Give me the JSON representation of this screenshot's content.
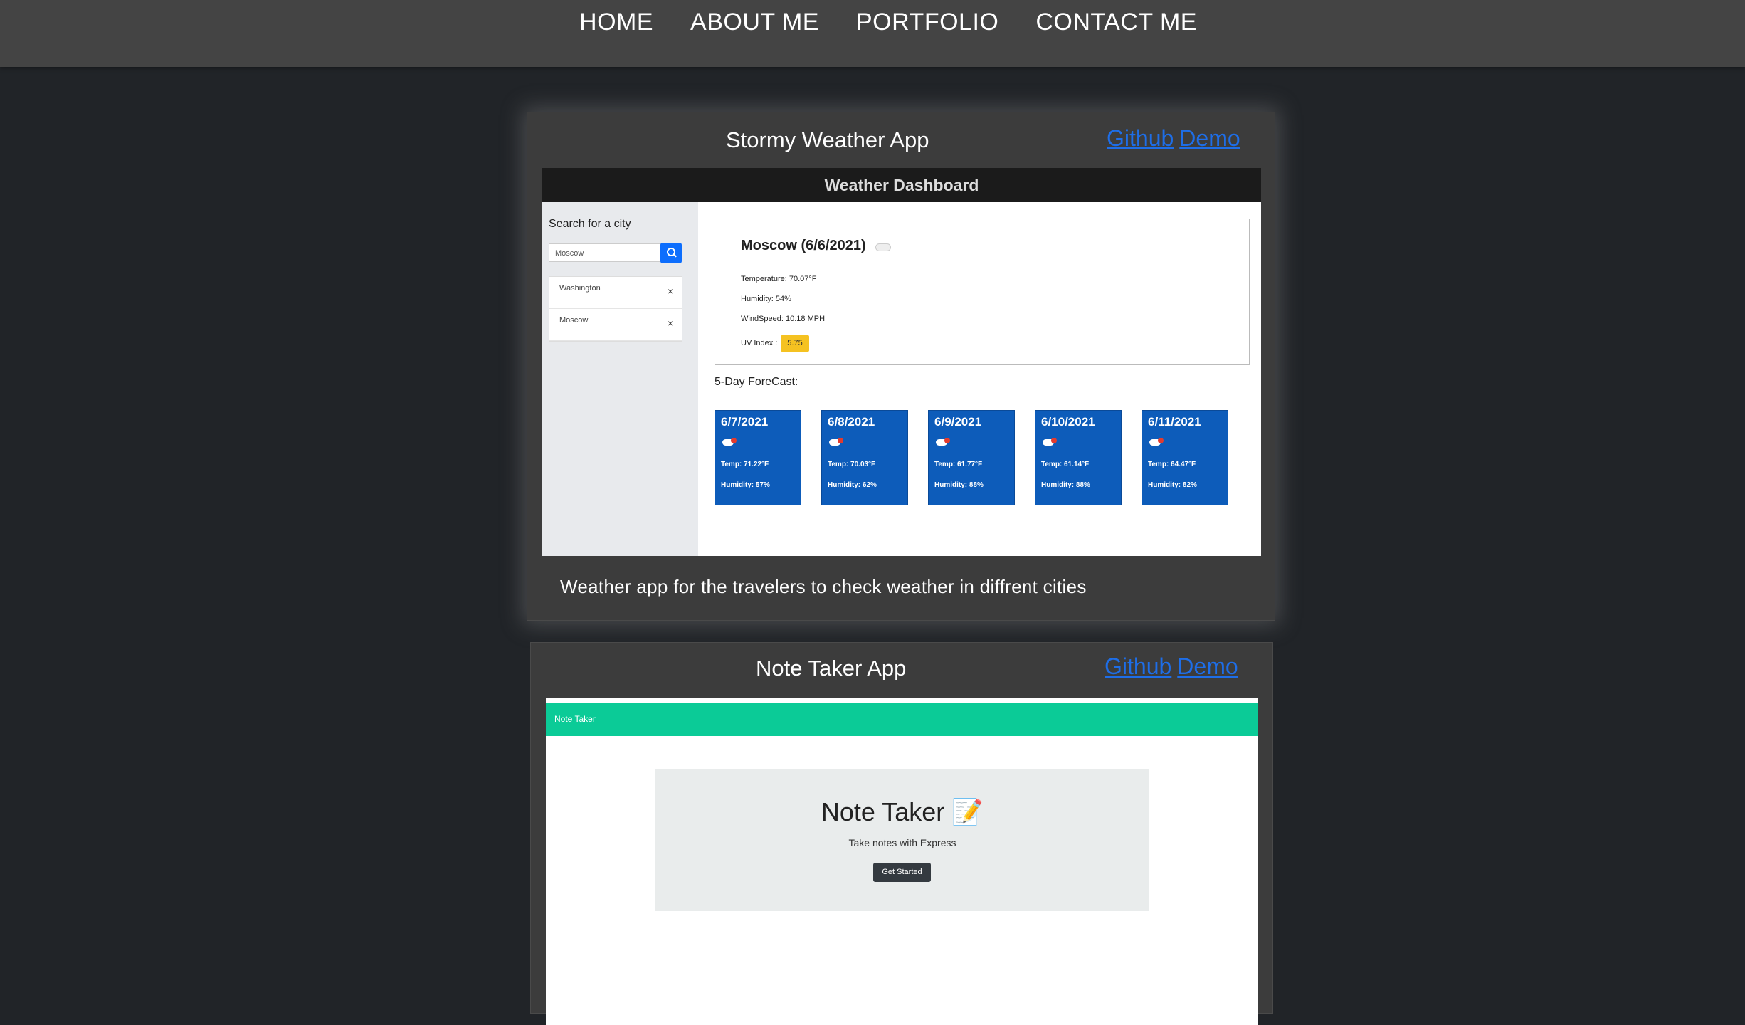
{
  "nav": {
    "items": [
      "HOME",
      "ABOUT ME",
      "PORTFOLIO",
      "CONTACT ME"
    ]
  },
  "projects": [
    {
      "title": "Stormy Weather App",
      "github_label": "Github",
      "demo_label": "Demo",
      "description": "Weather app for the travelers to check weather in diffrent cities",
      "screenshot": {
        "header": "Weather Dashboard",
        "search_label": "Search for a city",
        "search_value": "Moscow",
        "history": [
          "Washington",
          "Moscow"
        ],
        "remove_glyph": "×",
        "city_heading": "Moscow (6/6/2021)",
        "temperature": "Temperature: 70.07°F",
        "humidity": "Humidity: 54%",
        "windspeed": "WindSpeed: 10.18 MPH",
        "uv_label": "UV Index :",
        "uv_value": "5.75",
        "forecast_label": "5-Day ForeCast:",
        "forecast": [
          {
            "date": "6/7/2021",
            "temp": "Temp: 71.22°F",
            "humidity": "Humidity: 57%"
          },
          {
            "date": "6/8/2021",
            "temp": "Temp: 70.03°F",
            "humidity": "Humidity: 62%"
          },
          {
            "date": "6/9/2021",
            "temp": "Temp: 61.77°F",
            "humidity": "Humidity: 88%"
          },
          {
            "date": "6/10/2021",
            "temp": "Temp: 61.14°F",
            "humidity": "Humidity: 88%"
          },
          {
            "date": "6/11/2021",
            "temp": "Temp: 64.47°F",
            "humidity": "Humidity: 82%"
          }
        ]
      }
    },
    {
      "title": "Note Taker App",
      "github_label": "Github",
      "demo_label": "Demo",
      "screenshot": {
        "brand": "Note Taker",
        "title": "Note Taker 📝",
        "subtitle": "Take notes with Express",
        "button": "Get Started"
      }
    }
  ],
  "colors": {
    "background": "#212428",
    "nav": "#444444",
    "card": "#3c3c3c",
    "link": "#1e6ee8",
    "forecast_card": "#0d5cba",
    "note_header": "#0bcb97",
    "uv_badge": "#f5c221"
  }
}
